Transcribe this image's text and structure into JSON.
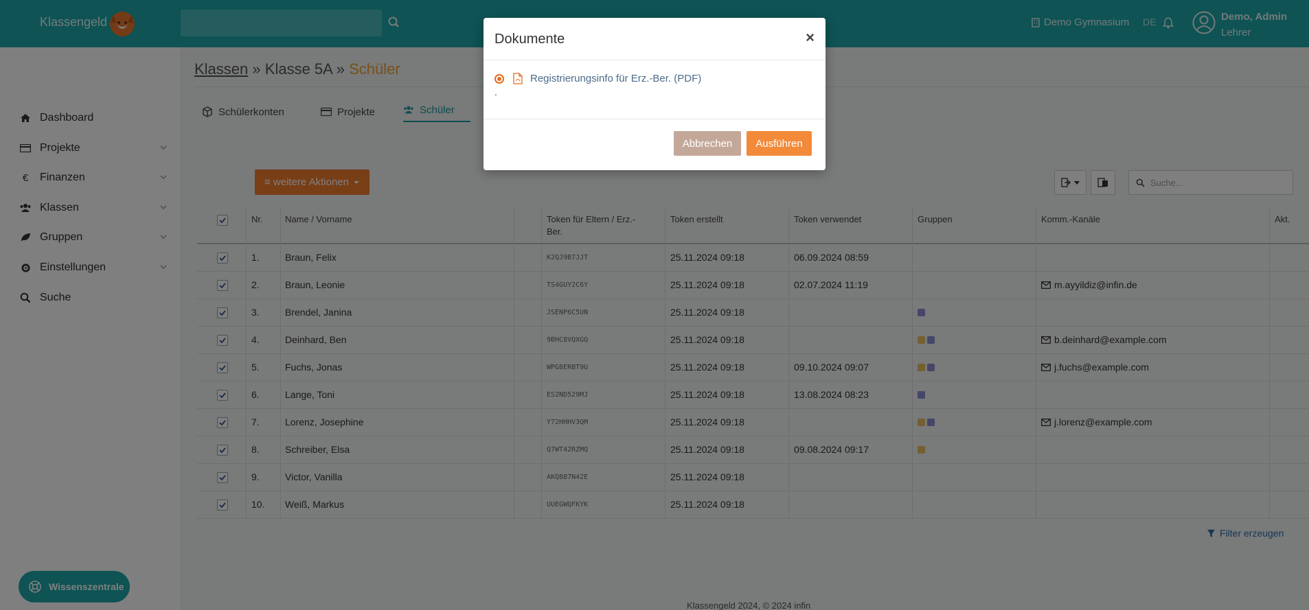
{
  "header": {
    "app_name": "Klassengeld",
    "school": "Demo Gymnasium",
    "language": "DE",
    "user_name": "Demo, Admin",
    "user_role": "Lehrer"
  },
  "sidebar": {
    "items": [
      {
        "label": "Dashboard"
      },
      {
        "label": "Projekte"
      },
      {
        "label": "Finanzen"
      },
      {
        "label": "Klassen"
      },
      {
        "label": "Gruppen"
      },
      {
        "label": "Einstellungen"
      },
      {
        "label": "Suche"
      }
    ],
    "help_button": "Wissenszentrale"
  },
  "breadcrumb": {
    "root": "Klassen",
    "sep": "»",
    "middle": "Klasse 5A",
    "current": "Schüler"
  },
  "tabs": [
    {
      "label": "Schülerkonten"
    },
    {
      "label": "Projekte"
    },
    {
      "label": "Schüler"
    }
  ],
  "toolbar": {
    "actions_label": "≡ weitere Aktionen",
    "search_placeholder": "Suche..."
  },
  "table": {
    "headers": [
      "Nr.",
      "Name / Vorname",
      "Token für Eltern / Erz.-Ber.",
      "Token erstellt",
      "Token verwendet",
      "Gruppen",
      "Komm.-Kanäle",
      "Akt."
    ],
    "rows": [
      {
        "nr": "1.",
        "name": "Braun, Felix",
        "token": "K2QJ9B7JJT",
        "created": "25.11.2024 09:18",
        "used": "06.09.2024 08:59",
        "groups": [],
        "mail": ""
      },
      {
        "nr": "2.",
        "name": "Braun, Leonie",
        "token": "TS4GUY2C6Y",
        "created": "25.11.2024 09:18",
        "used": "02.07.2024 11:19",
        "groups": [],
        "mail": "m.ayyildiz@infin.de"
      },
      {
        "nr": "3.",
        "name": "Brendel, Janina",
        "token": "JSENP6C5UN",
        "created": "25.11.2024 09:18",
        "used": "",
        "groups": [
          "#8a8fd0"
        ],
        "mail": ""
      },
      {
        "nr": "4.",
        "name": "Deinhard, Ben",
        "token": "9BHC8VQXGQ",
        "created": "25.11.2024 09:18",
        "used": "",
        "groups": [
          "#e8c060",
          "#8a8fd0"
        ],
        "mail": "b.deinhard@example.com"
      },
      {
        "nr": "5.",
        "name": "Fuchs, Jonas",
        "token": "WPG8ERBT9U",
        "created": "25.11.2024 09:18",
        "used": "09.10.2024 09:07",
        "groups": [
          "#e8c060",
          "#8a8fd0"
        ],
        "mail": "j.fuchs@example.com"
      },
      {
        "nr": "6.",
        "name": "Lange, Toni",
        "token": "ES2ND529MJ",
        "created": "25.11.2024 09:18",
        "used": "13.08.2024 08:23",
        "groups": [
          "#8a8fd0"
        ],
        "mail": ""
      },
      {
        "nr": "7.",
        "name": "Lorenz, Josephine",
        "token": "Y72HHHV3QM",
        "created": "25.11.2024 09:18",
        "used": "",
        "groups": [
          "#e8c060",
          "#8a8fd0"
        ],
        "mail": "j.lorenz@example.com"
      },
      {
        "nr": "8.",
        "name": "Schreiber, Elsa",
        "token": "Q7WT42RZMQ",
        "created": "25.11.2024 09:18",
        "used": "09.08.2024 09:17",
        "groups": [
          "#e8c060"
        ],
        "mail": ""
      },
      {
        "nr": "9.",
        "name": "Victor, Vanilla",
        "token": "AKQ887N42E",
        "created": "25.11.2024 09:18",
        "used": "",
        "groups": [],
        "mail": ""
      },
      {
        "nr": "10.",
        "name": "Weiß, Markus",
        "token": "UUEGWQFKYK",
        "created": "25.11.2024 09:18",
        "used": "",
        "groups": [],
        "mail": ""
      }
    ]
  },
  "filter_label": "Filter erzeugen",
  "footer": "Klassengeld 2024, © 2024 infin",
  "modal": {
    "title": "Dokumente",
    "close": "×",
    "option_label": "Registrierungsinfo für Erz.-Ber. (PDF)",
    "dot": ".",
    "cancel_label": "Abbrechen",
    "run_label": "Ausführen"
  },
  "colors": {
    "brand": "#1ea7a9",
    "accent": "#f07c2c",
    "group_yellow": "#e8c060",
    "group_purple": "#8a8fd0"
  }
}
